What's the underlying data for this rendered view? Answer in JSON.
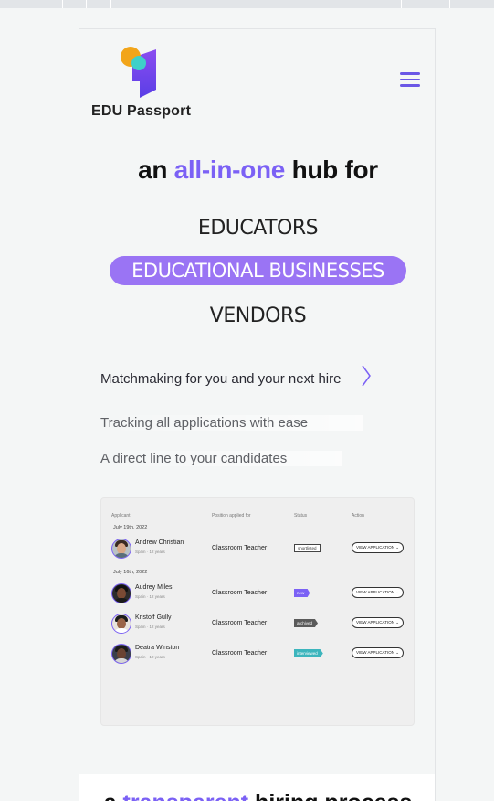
{
  "brand": {
    "name": "EDU Passport"
  },
  "hero": {
    "pre": "an",
    "accent": "all-in-one",
    "post": "hub for"
  },
  "roles": [
    "EDUCATORS",
    "EDUCATIONAL BUSINESSES",
    "VENDORS"
  ],
  "features": [
    "Matchmaking for you and your next hire",
    "Tracking all applications with ease",
    "A direct line to your candidates"
  ],
  "table": {
    "headers": [
      "Applicant",
      "Position applied for",
      "Status",
      "Action"
    ],
    "groups": [
      {
        "date": "July 19th, 2022",
        "rows": [
          {
            "name": "Andrew Christian",
            "meta": "Spain · 12 years",
            "position": "Classroom Teacher",
            "status": "shortlisted",
            "action": "VIEW APPLICATION ⌄"
          }
        ]
      },
      {
        "date": "July 16th, 2022",
        "rows": [
          {
            "name": "Audrey Miles",
            "meta": "Spain · 12 years",
            "position": "Classroom Teacher",
            "status": "new",
            "action": "VIEW APPLICATION ⌄"
          },
          {
            "name": "Kristoff Gully",
            "meta": "Spain · 12 years",
            "position": "Classroom Teacher",
            "status": "archived",
            "action": "VIEW APPLICATION ⌄"
          },
          {
            "name": "Deatra Winston",
            "meta": "Spain · 12 years",
            "position": "Classroom Teacher",
            "status": "interviewed",
            "action": "VIEW APPLICATION ⌄"
          }
        ]
      }
    ]
  },
  "footer_heading": {
    "pre": "a",
    "accent": "transparent",
    "post": "hiring process"
  },
  "colors": {
    "accent": "#7b61f5",
    "pill": "#9a74f4",
    "teal": "#3cb5bd",
    "gold": "#f2a51a"
  },
  "icons": {
    "menu": "hamburger-icon",
    "next": "chevron-right-icon"
  }
}
